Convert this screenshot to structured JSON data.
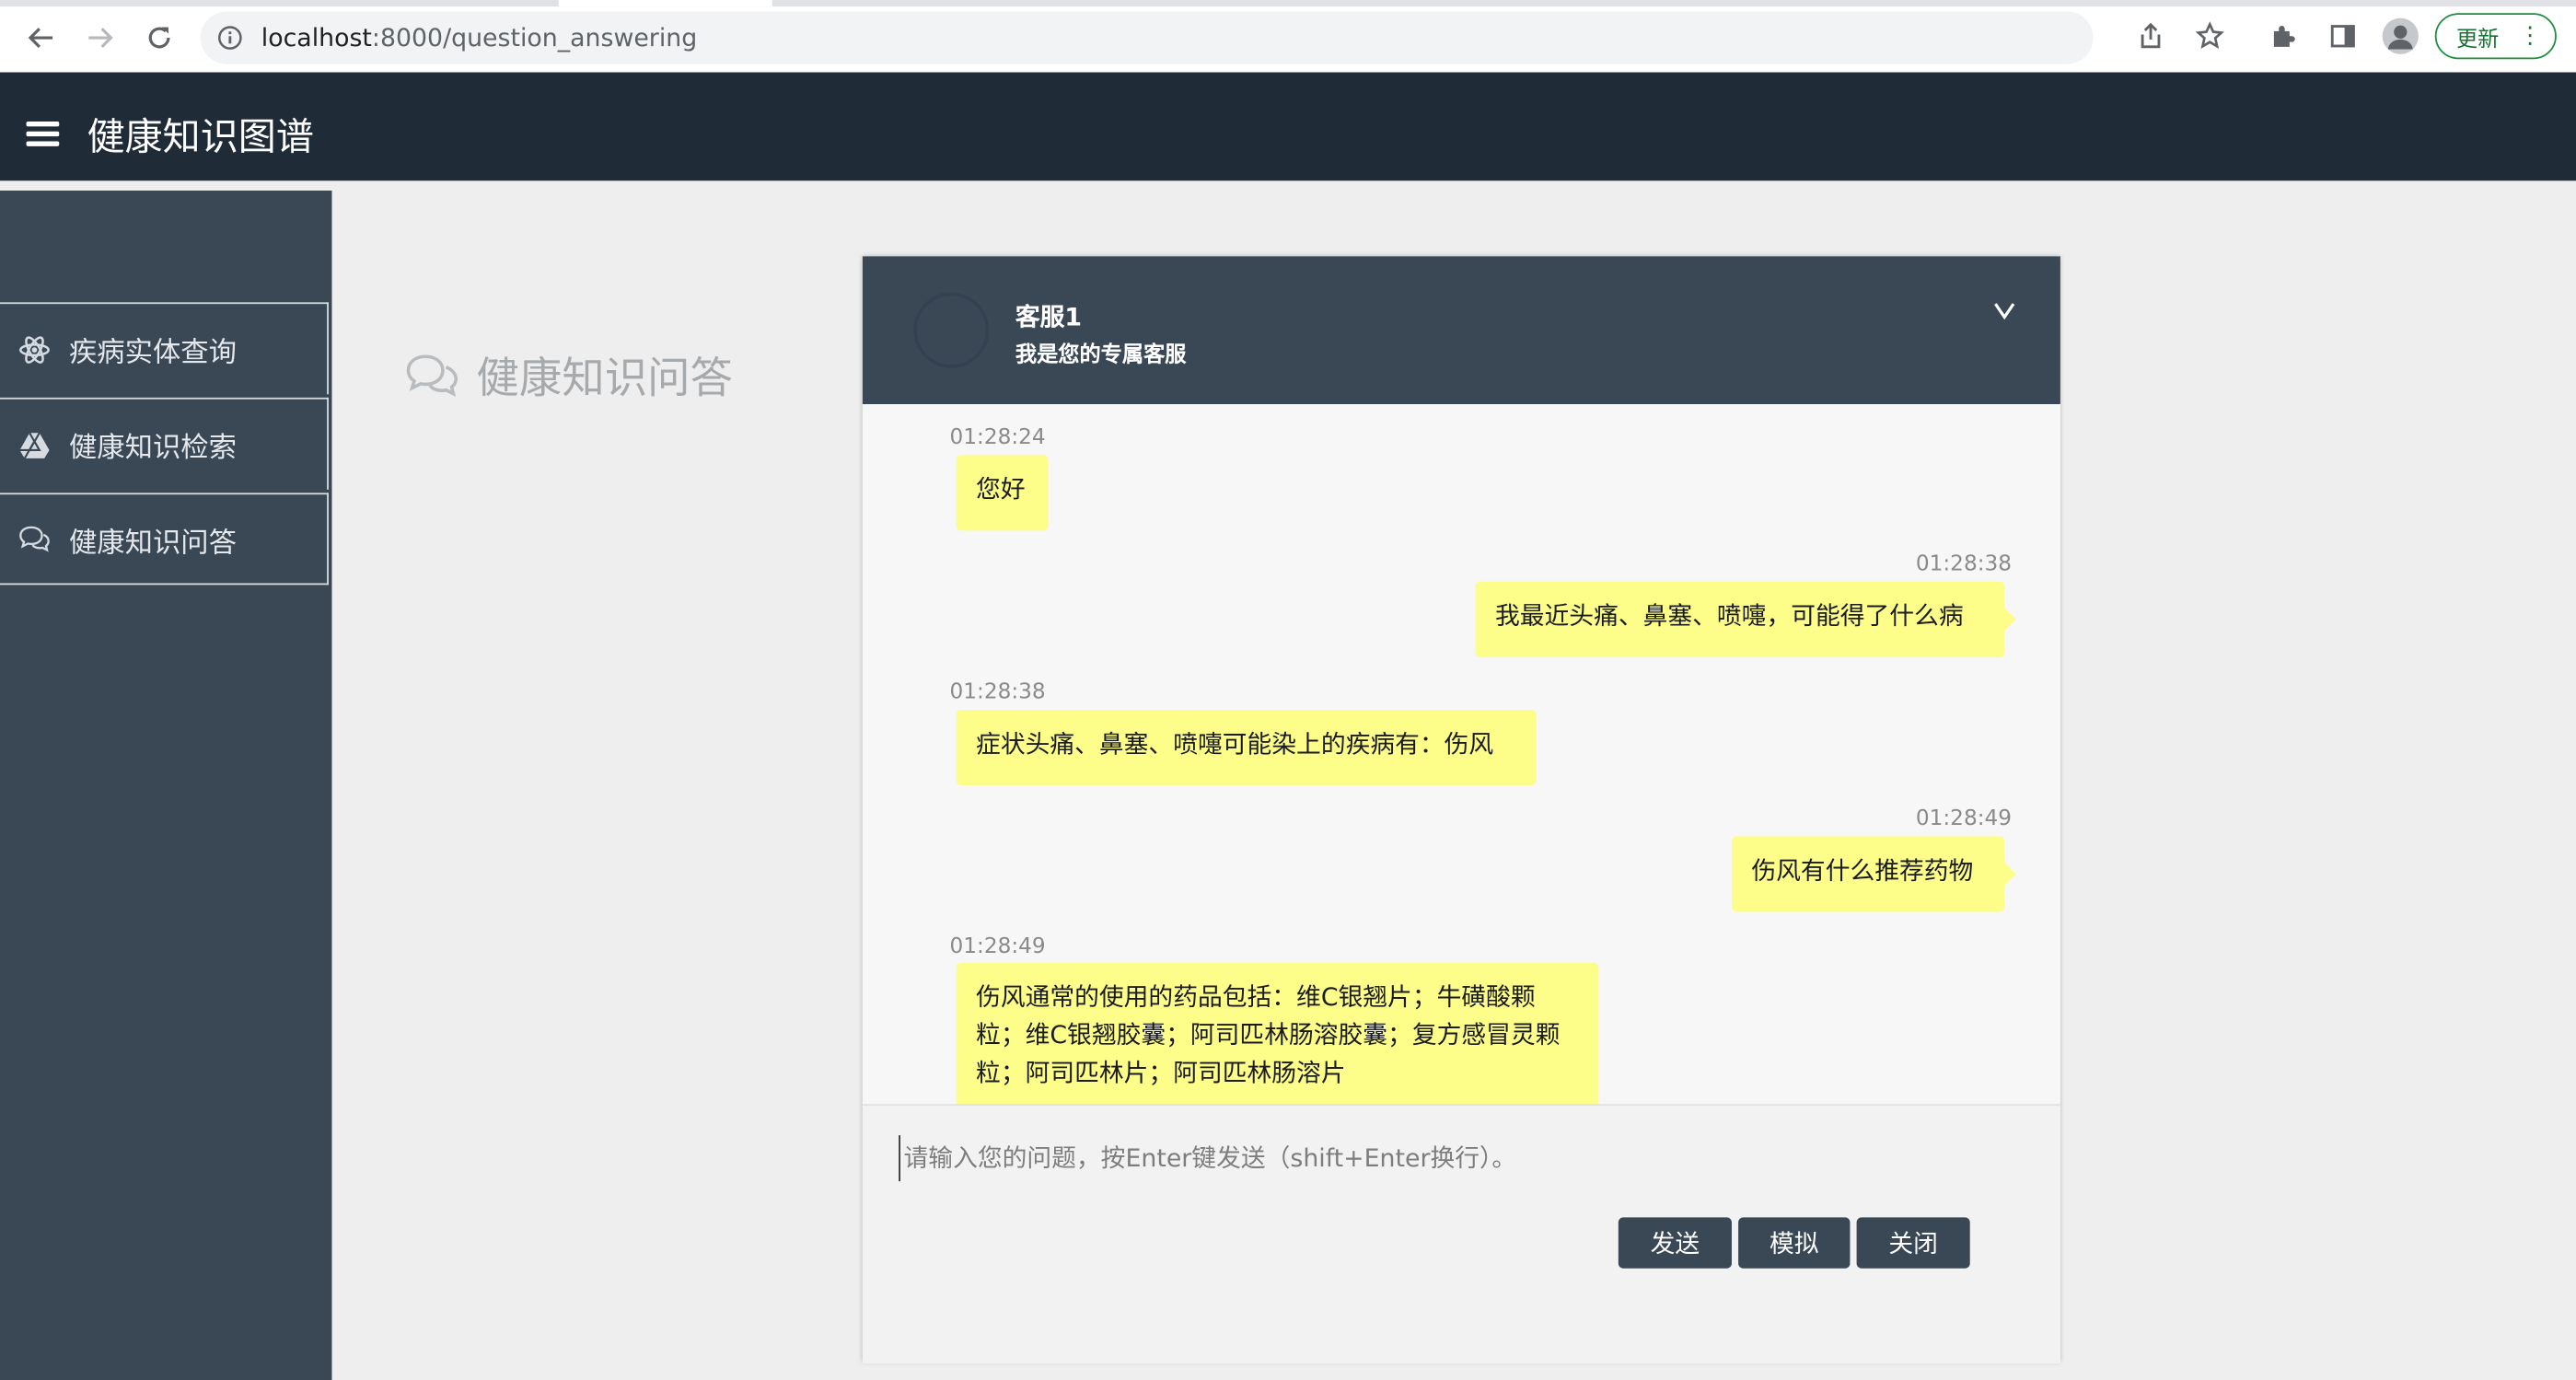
{
  "browser": {
    "url_host": "localhost",
    "url_path": ":8000/question_answering",
    "update_label": "更新"
  },
  "header": {
    "title": "健康知识图谱"
  },
  "sidebar": {
    "items": [
      {
        "label": "疾病实体查询",
        "icon": "atom-icon"
      },
      {
        "label": "健康知识检索",
        "icon": "drive-icon"
      },
      {
        "label": "健康知识问答",
        "icon": "chat-bubbles-icon"
      }
    ]
  },
  "page": {
    "title": "健康知识问答",
    "title_icon": "chat-bubbles-icon"
  },
  "chat": {
    "agent_name": "客服1",
    "agent_subtitle": "我是您的专属客服",
    "toggle_glyph": "v",
    "messages": [
      {
        "side": "left",
        "time": "01:28:24",
        "text": "您好"
      },
      {
        "side": "right",
        "time": "01:28:38",
        "text": "我最近头痛、鼻塞、喷嚏，可能得了什么病"
      },
      {
        "side": "left",
        "time": "01:28:38",
        "text": "症状头痛、鼻塞、喷嚏可能染上的疾病有：伤风"
      },
      {
        "side": "right",
        "time": "01:28:49",
        "text": "伤风有什么推荐药物"
      },
      {
        "side": "left",
        "time": "01:28:49",
        "text": "伤风通常的使用的药品包括：维C银翘片；牛磺酸颗粒；维C银翘胶囊；阿司匹林肠溶胶囊；复方感冒灵颗粒；阿司匹林片；阿司匹林肠溶片"
      }
    ],
    "input_placeholder": "请输入您的问题，按Enter键发送（shift+Enter换行）。",
    "buttons": {
      "send": "发送",
      "simulate": "模拟",
      "close": "关闭"
    }
  },
  "colors": {
    "header_bg": "#1f2b37",
    "sidebar_bg": "#3a4856",
    "bubble_bg": "#fdfd8a",
    "button_bg": "#3a4856",
    "update_green": "#137333"
  }
}
